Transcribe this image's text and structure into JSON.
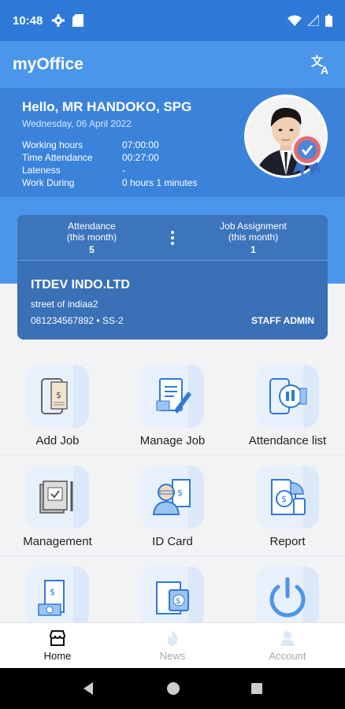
{
  "status_bar": {
    "time": "10:48"
  },
  "app": {
    "title": "myOffice"
  },
  "profile": {
    "greeting": "Hello, MR HANDOKO, SPG",
    "date": "Wednesday, 06 April 2022",
    "rows": [
      {
        "label": "Working hours",
        "value": "07:00:00"
      },
      {
        "label": "Time Attendance",
        "value": "00:27:00"
      },
      {
        "label": "Lateness",
        "value": "-"
      },
      {
        "label": "Work During",
        "value": "0 hours 1  minutes"
      }
    ]
  },
  "summary": {
    "attendance_label_1": "Attendance",
    "attendance_label_2": "(this month)",
    "attendance_value": "5",
    "job_label_1": "Job Assignment",
    "job_label_2": "(this month)",
    "job_value": "1",
    "company": "ITDEV INDO.LTD",
    "street": "street of indiaa2",
    "phone": "081234567892 • SS-2",
    "role": "STAFF ADMIN"
  },
  "menu": [
    {
      "label": "Add Job",
      "icon": "add-job-icon"
    },
    {
      "label": "Manage Job",
      "icon": "manage-job-icon"
    },
    {
      "label": "Attendance list",
      "icon": "attendance-list-icon"
    },
    {
      "label": "Management",
      "icon": "management-icon"
    },
    {
      "label": "ID Card",
      "icon": "id-card-icon"
    },
    {
      "label": "Report",
      "icon": "report-icon"
    },
    {
      "label": "",
      "icon": "payslip-icon"
    },
    {
      "label": "",
      "icon": "salary-icon"
    },
    {
      "label": "",
      "icon": "power-icon"
    }
  ],
  "bottom_nav": [
    {
      "label": "Home",
      "active": true
    },
    {
      "label": "News",
      "active": false
    },
    {
      "label": "Account",
      "active": false
    }
  ],
  "colors": {
    "primary": "#4b96ea",
    "card": "#3a70b5",
    "tile_bg": "#dbe8fa"
  }
}
